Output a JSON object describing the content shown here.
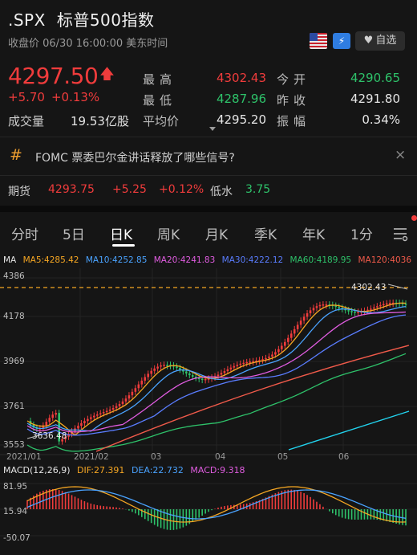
{
  "header": {
    "symbol": ".SPX",
    "name": "标普500指数",
    "status": "收盘价 06/30 16:00:00 美东时间",
    "flag_icon": "us-flag-icon",
    "ticket_icon": "lightning-ticket-icon",
    "ticket_text": "⚡",
    "favorite_label": "自选"
  },
  "quote": {
    "price": "4297.50",
    "change": "+5.70",
    "change_pct": "+0.13%",
    "volume_label": "成交量",
    "volume": "19.53亿股",
    "high_label": "最高",
    "high": "4302.43",
    "low_label": "最低",
    "low": "4287.96",
    "avg_label": "平均价",
    "avg": "4295.20",
    "open_label": "今开",
    "open": "4290.65",
    "prev_close_label": "昨收",
    "prev_close": "4291.80",
    "amplitude_label": "振幅",
    "amplitude": "0.34%"
  },
  "news": {
    "icon": "#",
    "text": "FOMC 票委巴尔金讲话释放了哪些信号?",
    "close": "×"
  },
  "futures": {
    "label": "期货",
    "price": "4293.75",
    "change": "+5.25",
    "change_pct": "+0.12%",
    "basis_label": "低水",
    "basis": "3.75"
  },
  "tabs": [
    "分时",
    "5日",
    "日K",
    "周K",
    "月K",
    "季K",
    "年K",
    "1分"
  ],
  "active_tab": "日K",
  "ma_legend": {
    "label": "MA",
    "ma5": "MA5:4285.42",
    "ma10": "MA10:4252.85",
    "ma20": "MA20:4241.83",
    "ma30": "MA30:4222.12",
    "ma60": "MA60:4189.95",
    "ma120": "MA120:4036"
  },
  "macd_legend": {
    "label": "MACD(12,26,9)",
    "dif": "DIF:27.391",
    "dea": "DEA:22.732",
    "macd": "MACD:9.318"
  },
  "colors": {
    "red": "#f03c3c",
    "green": "#2ec26a",
    "ma5": "#f5a623",
    "ma10": "#4aa3ff",
    "ma20": "#e05ce0",
    "ma30": "#5a7dff",
    "ma60": "#2ec26a",
    "ma120": "#f05a4a",
    "ma250": "#22d3ee"
  },
  "chart_data": {
    "type": "candlestick",
    "y_ticks": [
      "4386",
      "4178",
      "3969",
      "3761",
      "3553"
    ],
    "x_ticks": [
      "2021/01",
      "2021/02",
      "03",
      "04",
      "05",
      "06"
    ],
    "annotations": [
      "4302.43",
      "3636.48"
    ],
    "reference_line": 4302.43,
    "macd_y_ticks": [
      "81.95",
      "15.94",
      "-50.07"
    ]
  }
}
